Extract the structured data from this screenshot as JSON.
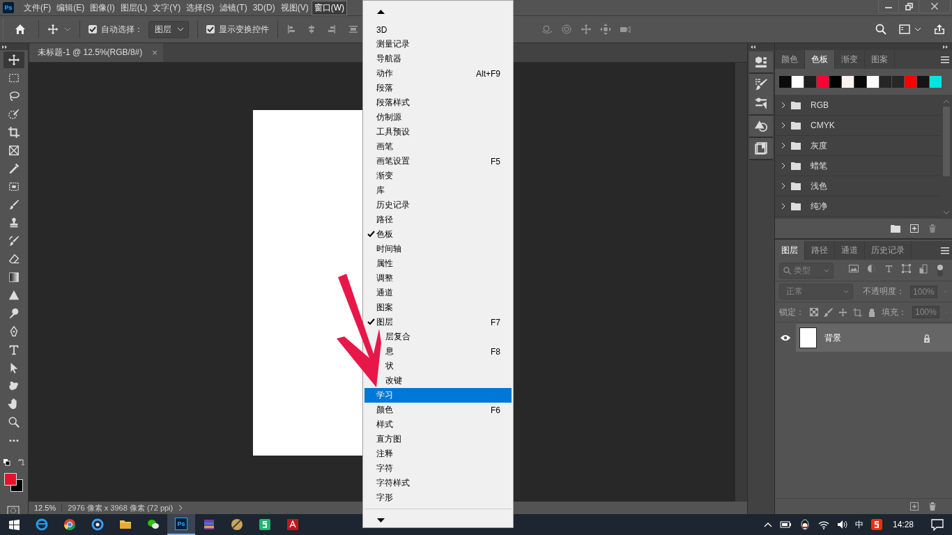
{
  "app_logo": "Ps",
  "menubar": {
    "items": [
      {
        "label": "文件(F)",
        "selected": false
      },
      {
        "label": "编辑(E)",
        "selected": false
      },
      {
        "label": "图像(I)",
        "selected": false
      },
      {
        "label": "图层(L)",
        "selected": false
      },
      {
        "label": "文字(Y)",
        "selected": false
      },
      {
        "label": "选择(S)",
        "selected": false
      },
      {
        "label": "滤镜(T)",
        "selected": false
      },
      {
        "label": "3D(D)",
        "selected": false
      },
      {
        "label": "视图(V)",
        "selected": false
      },
      {
        "label": "窗口(W)",
        "selected": true
      }
    ]
  },
  "options_bar": {
    "auto_select": {
      "label": "自动选择：",
      "checked": true
    },
    "target": {
      "value": "图层"
    },
    "transform_controls": {
      "label": "显示变换控件",
      "checked": true
    }
  },
  "document_tab": {
    "title": "未标题-1 @ 12.5%(RGB/8#)",
    "close": "×"
  },
  "toolbar": {
    "tools": [
      {
        "kind": "move",
        "selected": true
      },
      {
        "kind": "marquee",
        "selected": false
      },
      {
        "kind": "lasso",
        "selected": false
      },
      {
        "kind": "quick-select",
        "selected": false
      },
      {
        "kind": "crop",
        "selected": false
      },
      {
        "kind": "frame",
        "selected": false
      },
      {
        "kind": "eyedropper",
        "selected": false
      },
      {
        "kind": "patch",
        "selected": false
      },
      {
        "kind": "brush",
        "selected": false
      },
      {
        "kind": "stamp",
        "selected": false
      },
      {
        "kind": "history-brush",
        "selected": false
      },
      {
        "kind": "eraser",
        "selected": false
      },
      {
        "kind": "gradient",
        "selected": false
      },
      {
        "kind": "blur",
        "selected": false
      },
      {
        "kind": "dodge",
        "selected": false
      },
      {
        "kind": "pen",
        "selected": false
      },
      {
        "kind": "type",
        "selected": false
      },
      {
        "kind": "path-select",
        "selected": false
      },
      {
        "kind": "shape",
        "selected": false
      },
      {
        "kind": "hand",
        "selected": false
      },
      {
        "kind": "zoom",
        "selected": false
      },
      {
        "kind": "more",
        "selected": false
      }
    ]
  },
  "status_bar": {
    "zoom": "12.5%",
    "info": "2976 像素 x 3968 像素 (72 ppi)"
  },
  "window_menu": {
    "items": [
      {
        "label": "3D",
        "checked": false,
        "selected": false
      },
      {
        "label": "测量记录",
        "checked": false,
        "selected": false
      },
      {
        "label": "导航器",
        "checked": false,
        "selected": false
      },
      {
        "label": "动作",
        "shortcut": "Alt+F9",
        "checked": false,
        "selected": false
      },
      {
        "label": "段落",
        "checked": false,
        "selected": false
      },
      {
        "label": "段落样式",
        "checked": false,
        "selected": false
      },
      {
        "label": "仿制源",
        "checked": false,
        "selected": false
      },
      {
        "label": "工具预设",
        "checked": false,
        "selected": false
      },
      {
        "label": "画笔",
        "checked": false,
        "selected": false
      },
      {
        "label": "画笔设置",
        "shortcut": "F5",
        "checked": false,
        "selected": false
      },
      {
        "label": "渐变",
        "checked": false,
        "selected": false
      },
      {
        "label": "库",
        "checked": false,
        "selected": false
      },
      {
        "label": "历史记录",
        "checked": false,
        "selected": false
      },
      {
        "label": "路径",
        "checked": false,
        "selected": false
      },
      {
        "label": "色板",
        "checked": true,
        "selected": false
      },
      {
        "label": "时间轴",
        "checked": false,
        "selected": false
      },
      {
        "label": "属性",
        "checked": false,
        "selected": false
      },
      {
        "label": "调整",
        "checked": false,
        "selected": false
      },
      {
        "label": "通道",
        "checked": false,
        "selected": false
      },
      {
        "label": "图案",
        "checked": false,
        "selected": false
      },
      {
        "label": "图层",
        "shortcut": "F7",
        "checked": true,
        "selected": false
      },
      {
        "label": "层复合",
        "kind": "obscured",
        "selected": false
      },
      {
        "label": "息",
        "kind": "obscured",
        "shortcut": "F8",
        "selected": false
      },
      {
        "label": "状",
        "kind": "obscured",
        "selected": false
      },
      {
        "label": "改键",
        "kind": "obscured",
        "selected": false
      },
      {
        "label": "学习",
        "checked": false,
        "selected": true
      },
      {
        "label": "颜色",
        "shortcut": "F6",
        "checked": false,
        "selected": false
      },
      {
        "label": "样式",
        "checked": false,
        "selected": false
      },
      {
        "label": "直方图",
        "checked": false,
        "selected": false
      },
      {
        "label": "注释",
        "checked": false,
        "selected": false
      },
      {
        "label": "字符",
        "checked": false,
        "selected": false
      },
      {
        "label": "字符样式",
        "checked": false,
        "selected": false
      },
      {
        "label": "字形",
        "checked": false,
        "selected": false
      }
    ]
  },
  "swatches_panel": {
    "tabs": [
      {
        "label": "颜色",
        "selected": false
      },
      {
        "label": "色板",
        "selected": true
      },
      {
        "label": "渐变",
        "selected": false
      },
      {
        "label": "图案",
        "selected": false
      }
    ],
    "swatches": [
      {
        "color": "#0b0b0b"
      },
      {
        "color": "#ffffff"
      },
      {
        "color": "#1e1e1e"
      },
      {
        "color": "#ff0033"
      },
      {
        "color": "#000000"
      },
      {
        "color": "#fcf1ee"
      },
      {
        "color": "#080808"
      },
      {
        "color": "#ffffff"
      },
      {
        "color": "#262626"
      },
      {
        "color": "#272727"
      },
      {
        "color": "#ff0000"
      },
      {
        "color": "#141414"
      },
      {
        "color": "#00e4e4"
      }
    ],
    "groups": [
      {
        "name": "RGB",
        "expanded": false
      },
      {
        "name": "CMYK",
        "expanded": false
      },
      {
        "name": "灰度",
        "expanded": false
      },
      {
        "name": "蜡笔",
        "expanded": false
      },
      {
        "name": "浅色",
        "expanded": false
      },
      {
        "name": "纯净",
        "expanded": false
      }
    ]
  },
  "layers_panel": {
    "tabs": [
      {
        "label": "图层",
        "selected": true
      },
      {
        "label": "路径",
        "selected": false
      },
      {
        "label": "通道",
        "selected": false
      },
      {
        "label": "历史记录",
        "selected": false
      }
    ],
    "filter": {
      "placeholder": "类型",
      "disabled": true
    },
    "blend_mode": {
      "value": "正常",
      "disabled": true
    },
    "opacity": {
      "label": "不透明度：",
      "value": "100%",
      "disabled": true
    },
    "lock": {
      "label": "锁定："
    },
    "fill": {
      "label": "填充：",
      "value": "100%",
      "disabled": true
    },
    "layers": [
      {
        "name": "背景",
        "visible": true,
        "locked": true,
        "selected": true
      }
    ]
  },
  "taskbar": {
    "ps_label": "Ps",
    "input_method": "中",
    "time": "14:28"
  }
}
